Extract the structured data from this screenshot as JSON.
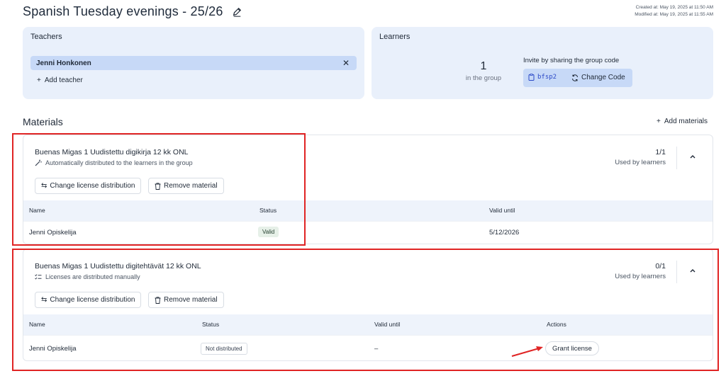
{
  "page": {
    "title": "Spanish Tuesday evenings - 25/26",
    "created": "Created at: May 19, 2025 at 11:50 AM",
    "modified": "Modified at: May 19, 2025 at 11:55 AM"
  },
  "teachers": {
    "title": "Teachers",
    "items": [
      "Jenni Honkonen"
    ],
    "add_label": "Add teacher"
  },
  "learners": {
    "title": "Learners",
    "count": "1",
    "count_label": "in the group",
    "invite_label": "Invite by sharing the group code",
    "code": "bfsp2",
    "change_code_label": "Change Code"
  },
  "materials": {
    "title": "Materials",
    "add_label": "Add materials",
    "items": [
      {
        "name": "Buenas Migas 1 Uudistettu digikirja 12 kk ONL",
        "distribution": "Automatically distributed to the learners in the group",
        "usage": "1/1",
        "usage_label": "Used by learners",
        "change_label": "Change license distribution",
        "remove_label": "Remove material",
        "columns": [
          "Name",
          "Status",
          "Valid until"
        ],
        "rows": [
          {
            "name": "Jenni Opiskelija",
            "status": "Valid",
            "valid_until": "5/12/2026"
          }
        ]
      },
      {
        "name": "Buenas Migas 1 Uudistettu digitehtävät 12 kk ONL",
        "distribution": "Licenses are distributed manually",
        "usage": "0/1",
        "usage_label": "Used by learners",
        "change_label": "Change license distribution",
        "remove_label": "Remove material",
        "columns": [
          "Name",
          "Status",
          "Valid until",
          "Actions"
        ],
        "rows": [
          {
            "name": "Jenni Opiskelija",
            "status": "Not distributed",
            "valid_until": "–",
            "action": "Grant license"
          }
        ]
      }
    ]
  },
  "colors": {
    "card_bg": "#e9f0fb",
    "chip_bg": "#c7d9f7",
    "highlight": "#e02424",
    "code_text": "#2b49c7"
  }
}
